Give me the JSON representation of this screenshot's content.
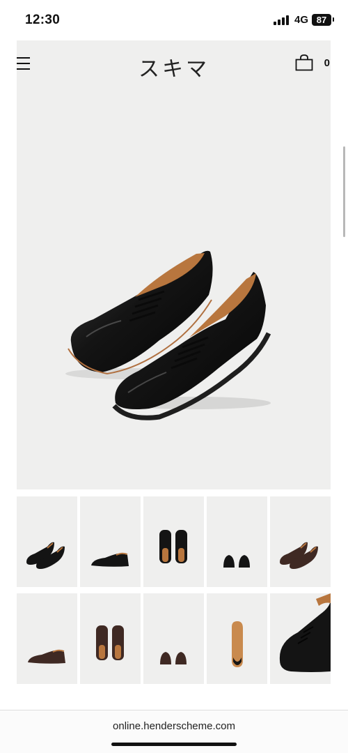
{
  "status_bar": {
    "time": "12:30",
    "network": "4G",
    "battery": "87"
  },
  "header": {
    "logo": "スキマ",
    "cart_count": "0",
    "menu_icon": "hamburger-icon",
    "cart_icon": "shopping-bag-icon"
  },
  "product": {
    "main_image": "black-oxford-shoes-pair",
    "thumbnails": [
      {
        "name": "black-pair-angled"
      },
      {
        "name": "black-single-side"
      },
      {
        "name": "black-pair-top"
      },
      {
        "name": "black-pair-back"
      },
      {
        "name": "brown-pair-angled"
      },
      {
        "name": "brown-single-side"
      },
      {
        "name": "brown-pair-top"
      },
      {
        "name": "brown-pair-back"
      },
      {
        "name": "sole-view"
      },
      {
        "name": "black-toe-closeup"
      }
    ]
  },
  "browser": {
    "url": "online.henderscheme.com"
  },
  "colors": {
    "background": "#efefee",
    "shoe_black": "#141414",
    "shoe_brown": "#3f2923",
    "leather_lining": "#b8763e"
  }
}
